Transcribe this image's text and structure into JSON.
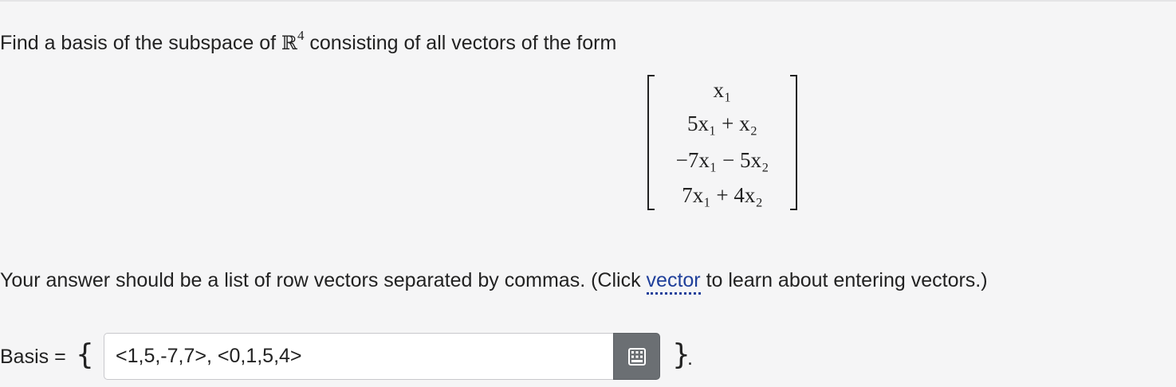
{
  "question": {
    "prefix": "Find a basis of the subspace of ",
    "space_symbol": "ℝ",
    "space_dim": "4",
    "suffix": " consisting of all vectors of the form"
  },
  "matrix": {
    "rows": [
      "x₁",
      "5x₁ + x₂",
      "−7x₁ − 5x₂",
      "7x₁ + 4x₂"
    ]
  },
  "instructions": {
    "before_link": "Your answer should be a list of row vectors separated by commas. (Click ",
    "link_text": "vector",
    "after_link": " to learn about entering vectors.)"
  },
  "answer": {
    "label": "Basis = ",
    "open_brace": "{",
    "value": "<1,5,-7,7>, <0,1,5,4>",
    "close_brace": "}",
    "period": "."
  },
  "icons": {
    "keypad": "keypad-grid-icon"
  },
  "colors": {
    "link": "#1f3f9a",
    "keypad_button": "#6b6f73",
    "background": "#f5f5f6"
  }
}
